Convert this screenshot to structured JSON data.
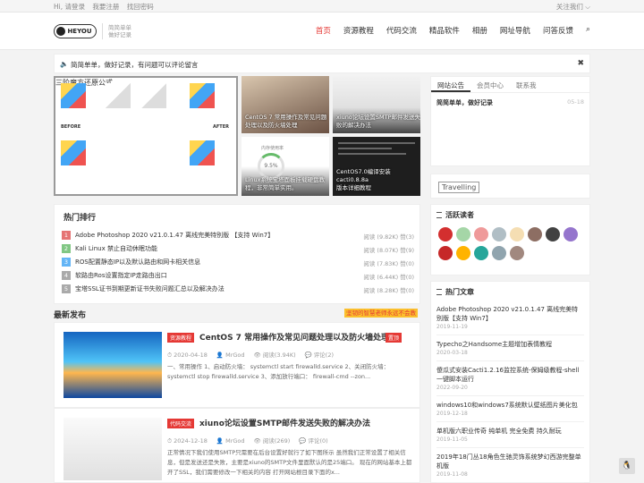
{
  "topbar": {
    "login": "Hi, 请登录",
    "register": "我要注册",
    "forgot": "找回密码",
    "follow": "关注我们 ⌵"
  },
  "header": {
    "logo": "HEYOU",
    "slogan1": "简简单单",
    "slogan2": "做好记录"
  },
  "nav": {
    "items": [
      "首页",
      "资源教程",
      "代码交流",
      "精品软件",
      "相册",
      "网址导航",
      "问答反馈"
    ],
    "search_icon": "⌕"
  },
  "notice": {
    "text": "简简单单，做好记录，有问题可以评论留言",
    "close": "✖"
  },
  "tiles": [
    {
      "caption": "三阶魔方还原公式"
    },
    {
      "caption": "CentOS 7 常用操作及常见问题\n处理以及防火墙处理"
    },
    {
      "caption": "xiuno论坛设置SMTP邮件发送失\n败的解决办法"
    },
    {
      "caption": "Linux系统宝塔面板挂载硬盘教\n程，非常简单实用。"
    },
    {
      "caption": "CentOS7.0编译安装cacti0.8.8a\n版本详细教程"
    }
  ],
  "cube_labels": {
    "before": "BEFORE",
    "after": "AFTER"
  },
  "tile4_label": "内存使用率",
  "tile4_value": "9.5%",
  "side_tabs": [
    "网站公告",
    "会员中心",
    "联系我"
  ],
  "side_notice": {
    "text": "简简单单，做好记录",
    "date": "05-18"
  },
  "travelling": "Travelling",
  "active_readers": {
    "title": "活跃读者"
  },
  "hot_articles": {
    "title": "热门文章",
    "items": [
      {
        "title": "Adobe Photoshop 2020 v21.0.1.47 离线完美特别版【支持 Win7】",
        "date": "2019-11-19"
      },
      {
        "title": "Typecho之Handsome主题增加表情教程",
        "date": "2020-03-18"
      },
      {
        "title": "傻瓜式安装Cacti1.2.16监控系统-保姆级教程-shell一键脚本运行",
        "date": "2022-09-20"
      },
      {
        "title": "windows10和windows7系统默认壁纸图片美化包",
        "date": "2019-12-18"
      },
      {
        "title": "单机版六职业传奇 纯单机 完全免费 持久耐玩",
        "date": "2019-11-05"
      },
      {
        "title": "2019年18门丛18角色生驰灵饰系统梦幻西游完整单机版",
        "date": "2019-11-08"
      }
    ]
  },
  "hot_rank": {
    "title": "热门排行",
    "rows": [
      {
        "num": "1",
        "color": "#e57373",
        "title": "Adobe Photoshop 2020 v21.0.1.47 离线完美特别版 【支持 Win7】",
        "meta": "阅读 (9.82K)  赞(3)"
      },
      {
        "num": "2",
        "color": "#81c784",
        "title": "Kali Linux 禁止自动休眠功能",
        "meta": "阅读 (8.07K)  赞(9)"
      },
      {
        "num": "3",
        "color": "#64b5f6",
        "title": "ROS配置静态IP以及默认路由和网卡相关信息",
        "meta": "阅读 (7.83K)  赞(0)"
      },
      {
        "num": "4",
        "color": "#aaaaaa",
        "title": "软路由Ros设置指定IP走路由出口",
        "meta": "阅读 (6.44K)  赞(0)"
      },
      {
        "num": "5",
        "color": "#aaaaaa",
        "title": "宝塔SSL证书到期更新证书失败问题汇总以及解决办法",
        "meta": "阅读 (8.28K)  赞(0)"
      }
    ]
  },
  "latest": {
    "title": "最新发布",
    "tag": "坚韧的智慧老师永远不会教"
  },
  "posts": [
    {
      "badge": "资源教程",
      "badge2": "置顶",
      "title": "CentOS 7 常用操作及常见问题处理以及防火墙处理",
      "date": "⏱ 2020-04-18",
      "author": "👤 MrGod",
      "views": "👁 阅读(3.94K)",
      "comments": "💬 评论(2)",
      "excerpt": "一、常用操作 1、启动防火墙： systemctl start firewalld.service 2、关闭防火墙：systemctl stop firewalld.service 3、添加放行端口： firewall-cmd --zon..."
    },
    {
      "badge": "代码交流",
      "title": "xiuno论坛设置SMTP邮件发送失败的解决办法",
      "date": "⏱ 2024-12-18",
      "author": "👤 MrGod",
      "views": "👁 阅读(269)",
      "comments": "💬 评论(0)",
      "excerpt": "正常情况下我们使用SMTP只需要在后台设置好就行了如下图所示 虽然我们正常设置了相关信息，但是发送还是失败，主要是xiuno的SMTP文件里面默认的是25端口。 现在的网站基本上都开了SSL，我们需要修改一下相关的内容 打开网站根目录下面的x..."
    }
  ]
}
